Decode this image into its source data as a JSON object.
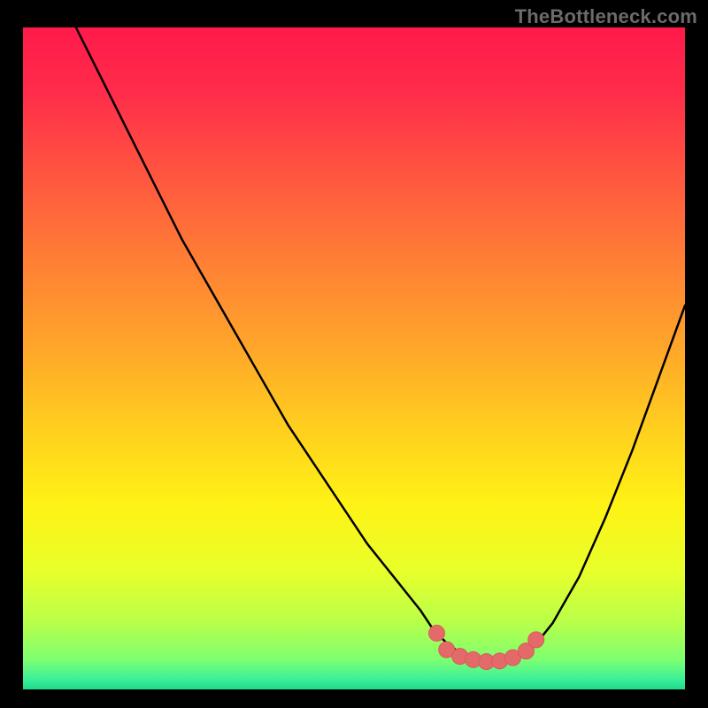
{
  "watermark": "TheBottleneck.com",
  "colors": {
    "frame": "#000000",
    "curve_stroke": "#000000",
    "marker_fill": "#e46a6a",
    "marker_stroke": "#d95a5a"
  },
  "chart_data": {
    "type": "line",
    "title": "",
    "xlabel": "",
    "ylabel": "",
    "xlim": [
      0,
      100
    ],
    "ylim": [
      0,
      100
    ],
    "gradient_stops": [
      {
        "offset": 0.0,
        "color": "#ff1a4b"
      },
      {
        "offset": 0.1,
        "color": "#ff2d4a"
      },
      {
        "offset": 0.22,
        "color": "#ff5540"
      },
      {
        "offset": 0.35,
        "color": "#ff7e35"
      },
      {
        "offset": 0.48,
        "color": "#ffa52a"
      },
      {
        "offset": 0.6,
        "color": "#ffcd1f"
      },
      {
        "offset": 0.72,
        "color": "#fff215"
      },
      {
        "offset": 0.82,
        "color": "#e8ff2a"
      },
      {
        "offset": 0.9,
        "color": "#b8ff4a"
      },
      {
        "offset": 0.955,
        "color": "#7dff70"
      },
      {
        "offset": 0.985,
        "color": "#3af09a"
      },
      {
        "offset": 1.0,
        "color": "#20d98a"
      }
    ],
    "series": [
      {
        "name": "bottleneck-curve",
        "x": [
          8,
          12,
          16,
          20,
          24,
          28,
          32,
          36,
          40,
          44,
          48,
          52,
          56,
          60,
          62,
          64,
          66,
          68,
          70,
          72,
          74,
          76,
          78,
          80,
          84,
          88,
          92,
          96,
          100
        ],
        "y": [
          100,
          92,
          84,
          76,
          68,
          61,
          54,
          47,
          40,
          34,
          28,
          22,
          17,
          12,
          9,
          7,
          5.5,
          4.5,
          4,
          4,
          4.5,
          5.5,
          7.5,
          10,
          17,
          26,
          36,
          47,
          58
        ]
      }
    ],
    "markers": [
      {
        "x": 62.5,
        "y": 8.5
      },
      {
        "x": 64.0,
        "y": 6.0
      },
      {
        "x": 66.0,
        "y": 5.0
      },
      {
        "x": 68.0,
        "y": 4.5
      },
      {
        "x": 70.0,
        "y": 4.2
      },
      {
        "x": 72.0,
        "y": 4.3
      },
      {
        "x": 74.0,
        "y": 4.8
      },
      {
        "x": 76.0,
        "y": 5.8
      },
      {
        "x": 77.5,
        "y": 7.5
      }
    ],
    "marker_radius_px": 9
  }
}
